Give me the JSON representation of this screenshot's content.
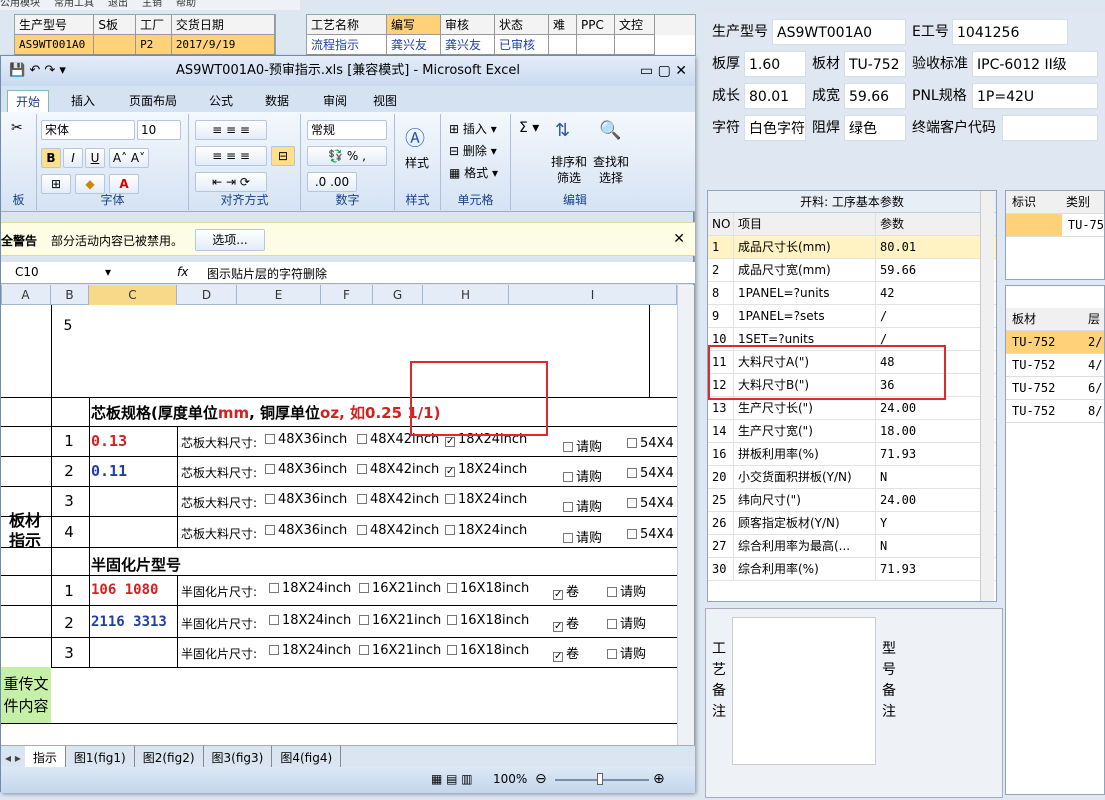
{
  "bg": {
    "menu": [
      "公用模块",
      "常用工具",
      "退出",
      "主销",
      "帮助"
    ],
    "left_headers": [
      "生产型号",
      "S板",
      "工厂",
      "交货日期"
    ],
    "left_row": [
      "AS9WT001A0",
      "",
      "P2",
      "2017/9/19"
    ],
    "mid_headers": [
      "工艺名称",
      "编写",
      "审核",
      "状态",
      "难",
      "PPC",
      "文控"
    ],
    "mid_row": [
      "流程指示",
      "龚兴友",
      "龚兴友",
      "已审核",
      "",
      "",
      ""
    ]
  },
  "right": {
    "prod_label": "生产型号",
    "prod_value": "AS9WT001A0",
    "e_label": "E工号",
    "e_value": "1041256",
    "thick_label": "板厚",
    "thick_value": "1.60",
    "mat_label": "板材",
    "mat_value": "TU-752",
    "std_label": "验收标准",
    "std_value": "IPC-6012 II级",
    "len_label": "成长",
    "len_value": "80.01",
    "wid_label": "成宽",
    "wid_value": "59.66",
    "pnl_label": "PNL规格",
    "pnl_value": "1P=42U",
    "char_label": "字符",
    "char_value": "白色字符",
    "mask_label": "阻焊",
    "mask_value": "绿色",
    "cust_label": "终端客户代码",
    "cust_value": ""
  },
  "param": {
    "title": "开料: 工序基本参数",
    "headers": [
      "NO",
      "项目",
      "参数"
    ],
    "rows": [
      [
        "1",
        "成品尺寸长(mm)",
        "80.01"
      ],
      [
        "2",
        "成品尺寸宽(mm)",
        "59.66"
      ],
      [
        "8",
        "1PANEL=?units",
        "42"
      ],
      [
        "9",
        "1PANEL=?sets",
        "/"
      ],
      [
        "10",
        "1SET=?units",
        "/"
      ],
      [
        "11",
        "大料尺寸A(\")",
        "48"
      ],
      [
        "12",
        "大料尺寸B(\")",
        "36"
      ],
      [
        "13",
        "生产尺寸长(\")",
        "24.00"
      ],
      [
        "14",
        "生产尺寸宽(\")",
        "18.00"
      ],
      [
        "16",
        "拼板利用率(%)",
        "71.93"
      ],
      [
        "20",
        "小交货面积拼板(Y/N)",
        "N"
      ],
      [
        "25",
        "纬向尺寸(\")",
        "24.00"
      ],
      [
        "26",
        "顾客指定板材(Y/N)",
        "Y"
      ],
      [
        "27",
        "综合利用率为最高(...",
        "N"
      ],
      [
        "30",
        "综合利用率(%)",
        "71.93"
      ]
    ]
  },
  "side1": {
    "headers": [
      "标识",
      "类别"
    ],
    "row": [
      "",
      "TU-75"
    ]
  },
  "side2": {
    "headers": [
      "板材",
      "层"
    ],
    "rows": [
      [
        "TU-752",
        "2/"
      ],
      [
        "TU-752",
        "4/"
      ],
      [
        "TU-752",
        "6/"
      ],
      [
        "TU-752",
        "8/"
      ]
    ]
  },
  "notes": {
    "left": "工艺备注",
    "right": "型号备注"
  },
  "excel": {
    "title": "AS9WT001A0-预审指示.xls [兼容模式] - Microsoft Excel",
    "tabs": [
      "开始",
      "插入",
      "页面布局",
      "公式",
      "数据",
      "审阅",
      "视图"
    ],
    "font": "宋体",
    "size": "10",
    "numfmt": "常规",
    "groups": [
      "板",
      "字体",
      "对齐方式",
      "数字",
      "样式",
      "单元格",
      "编辑"
    ],
    "style_label": "样式",
    "cell_btns": [
      "插入",
      "删除",
      "格式"
    ],
    "edit_btns": [
      "排序和筛选",
      "查找和选择"
    ],
    "security_title": "全警告",
    "security_msg": "部分活动内容已被禁用。",
    "security_btn": "选项...",
    "cell_ref": "C10",
    "formula": "图示贴片层的字符删除",
    "cols": [
      "A",
      "B",
      "C",
      "D",
      "E",
      "F",
      "G",
      "H",
      "I"
    ],
    "row5": "5",
    "core_title_a": "芯板规格(厚度单位",
    "core_title_mm": "mm",
    "core_title_b": ", 铜厚单位",
    "core_title_oz": "oz",
    "core_title_c": ", 如0.25 1/1)",
    "core_rows": [
      {
        "n": "1",
        "val": "0.13",
        "color": "#d42020"
      },
      {
        "n": "2",
        "val": "0.11",
        "color": "#1f3fa8"
      },
      {
        "n": "3",
        "val": "",
        "color": "#000"
      },
      {
        "n": "4",
        "val": "",
        "color": "#000"
      }
    ],
    "core_label": "芯板大料尺寸:",
    "core_opts": [
      "48X36inch",
      "48X42inch",
      "18X24inch",
      "请购",
      "54X4"
    ],
    "side_label": "板材指示",
    "pp_title": "半固化片型号",
    "pp_rows": [
      {
        "n": "1",
        "val": "106   1080",
        "color": "#d42020"
      },
      {
        "n": "2",
        "val": "2116  3313",
        "color": "#1f3fa8"
      },
      {
        "n": "3",
        "val": "",
        "color": "#000"
      }
    ],
    "pp_label": "半固化片尺寸:",
    "pp_opts": [
      "18X24inch",
      "16X21inch",
      "16X18inch",
      "卷",
      "请购"
    ],
    "bottom_label": "重传文件内容",
    "sheets": [
      "指示",
      "图1(fig1)",
      "图2(fig2)",
      "图3(fig3)",
      "图4(fig4)"
    ],
    "zoom": "100%"
  }
}
